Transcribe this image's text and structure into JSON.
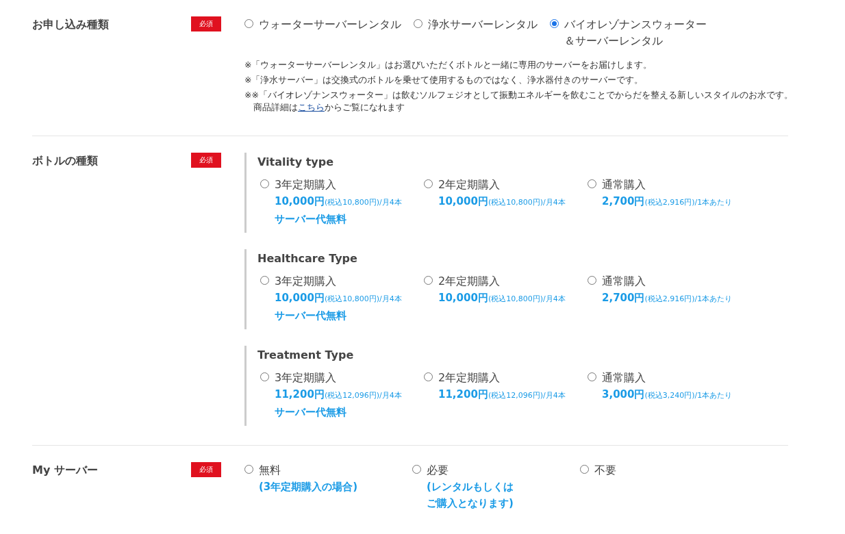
{
  "sections": [
    {
      "kind": "application",
      "label": "お申し込み種類",
      "badge": "必須",
      "options": [
        {
          "label": "ウォーターサーバーレンタル",
          "selected": false
        },
        {
          "label": "浄水サーバーレンタル",
          "selected": false
        },
        {
          "label": "バイオレゾナンスウォーター＆サーバーレンタル",
          "selected": true
        }
      ],
      "notes": [
        {
          "text": "※「ウォーターサーバーレンタル」はお選びいただくボトルと一緒に専用のサーバーをお届けします。"
        },
        {
          "text": "※「浄水サーバー」は交換式のボトルを乗せて使用するものではなく、浄水器付きのサーバーです。"
        },
        {
          "text": "※※「バイオレゾナンスウォーター」は飲むソルフェジオとして振動エネルギーを飲むことでからだを整える新しいスタイルのお水です。商品詳細は",
          "link": "こちら",
          "after": "からご覧になれます"
        }
      ]
    },
    {
      "kind": "bottles",
      "label": "ボトルの種類",
      "badge": "必須",
      "groups": [
        {
          "title": "Vitality type",
          "options": [
            {
              "label": "3年定期購入",
              "price": "10,000円",
              "tax": "(税込10,800円)",
              "unit": "/月4本",
              "extra": "サーバー代無料",
              "selected": false
            },
            {
              "label": "2年定期購入",
              "price": "10,000円",
              "tax": "(税込10,800円)",
              "unit": "/月4本",
              "selected": false
            },
            {
              "label": "通常購入",
              "price": "2,700円",
              "tax": "(税込2,916円)",
              "unit": "/1本あたり",
              "selected": false
            }
          ]
        },
        {
          "title": "Healthcare Type",
          "options": [
            {
              "label": "3年定期購入",
              "price": "10,000円",
              "tax": "(税込10,800円)",
              "unit": "/月4本",
              "extra": "サーバー代無料",
              "selected": false
            },
            {
              "label": "2年定期購入",
              "price": "10,000円",
              "tax": "(税込10,800円)",
              "unit": "/月4本",
              "selected": false
            },
            {
              "label": "通常購入",
              "price": "2,700円",
              "tax": "(税込2,916円)",
              "unit": "/1本あたり",
              "selected": false
            }
          ]
        },
        {
          "title": "Treatment Type",
          "options": [
            {
              "label": "3年定期購入",
              "price": "11,200円",
              "tax": "(税込12,096円)",
              "unit": "/月4本",
              "extra": "サーバー代無料",
              "selected": false
            },
            {
              "label": "2年定期購入",
              "price": "11,200円",
              "tax": "(税込12,096円)",
              "unit": "/月4本",
              "selected": false
            },
            {
              "label": "通常購入",
              "price": "3,000円",
              "tax": "(税込3,240円)",
              "unit": "/1本あたり",
              "selected": false
            }
          ]
        }
      ]
    },
    {
      "kind": "server",
      "label": "My サーバー",
      "badge": "必須",
      "options": [
        {
          "label": "無料",
          "note": "(3年定期購入の場合)",
          "selected": false
        },
        {
          "label": "必要",
          "note": "(レンタルもしくはご購入となります)",
          "selected": false
        },
        {
          "label": "不要",
          "selected": false
        }
      ]
    }
  ]
}
